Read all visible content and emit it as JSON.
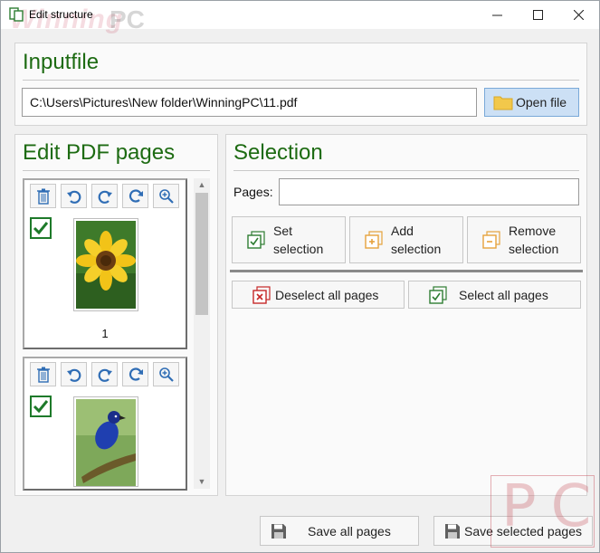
{
  "window": {
    "title": "Edit structure",
    "watermark_brand": "WinningPC"
  },
  "inputfile": {
    "heading": "Inputfile",
    "path": "C:\\Users\\Pictures\\New folder\\WinningPC\\11.pdf",
    "open_label": "Open file"
  },
  "editor": {
    "heading": "Edit PDF pages",
    "pages": [
      {
        "number": "1",
        "checked": true,
        "image": "sunflower"
      },
      {
        "number": "",
        "checked": true,
        "image": "blue-bird"
      }
    ]
  },
  "selection": {
    "heading": "Selection",
    "pages_label": "Pages:",
    "pages_value": "",
    "set_label_1": "Set",
    "set_label_2": "selection",
    "add_label_1": "Add",
    "add_label_2": "selection",
    "remove_label_1": "Remove",
    "remove_label_2": "selection",
    "deselect_all": "Deselect all pages",
    "select_all": "Select all pages"
  },
  "footer": {
    "save_all": "Save all pages",
    "save_selected": "Save selected pages"
  },
  "colors": {
    "heading": "#1d6b12",
    "accent": "#cce0f5",
    "orange": "#e6a23c",
    "red": "#c62828",
    "green": "#2e7d32"
  }
}
